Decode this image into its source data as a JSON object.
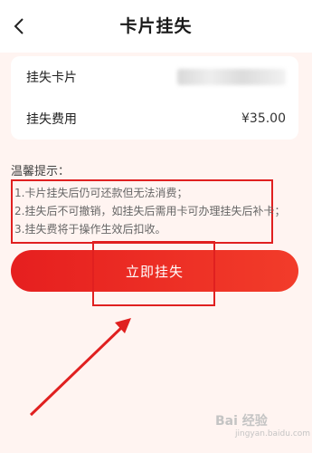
{
  "header": {
    "title": "卡片挂失",
    "back_icon": "chevron-left-icon"
  },
  "card_info": {
    "card_label": "挂失卡片",
    "card_value_masked": true,
    "fee_label": "挂失费用",
    "fee_value": "¥35.00"
  },
  "tips": {
    "title": "温馨提示：",
    "items": [
      "1.卡片挂失后仍可还款但无法消费；",
      "2.挂失后不可撤销，如挂失后需用卡可办理挂失后补卡；",
      "3.挂失费将于操作生效后扣收。"
    ]
  },
  "actions": {
    "report_loss_label": "立即挂失"
  },
  "watermark": {
    "brand": "Bai 经验",
    "site": "jingyan.baidu.com"
  },
  "colors": {
    "accent": "#e62222",
    "annotation": "#e02020",
    "background": "#fff4f1"
  }
}
